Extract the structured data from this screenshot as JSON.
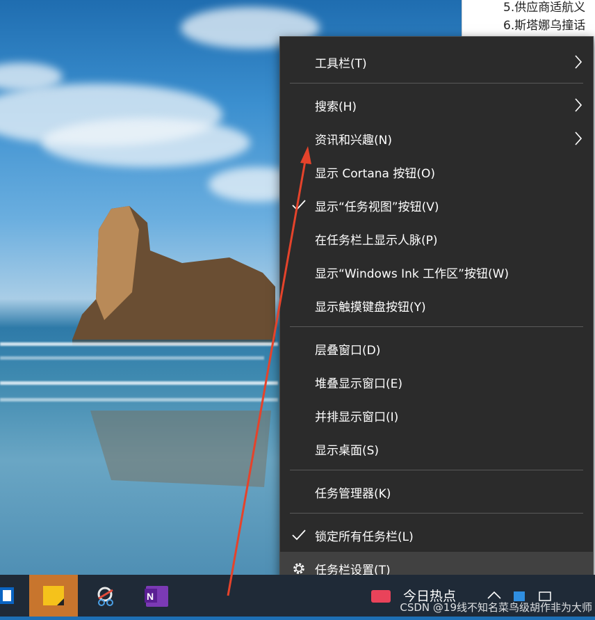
{
  "background_doc": {
    "lines": [
      "5.供应商适航义",
      "6.斯塔娜乌撞话"
    ]
  },
  "menu": {
    "items": [
      {
        "label": "工具栏(T)"
      },
      {
        "label": "搜索(H)"
      },
      {
        "label": "资讯和兴趣(N)"
      },
      {
        "label": "显示 Cortana 按钮(O)"
      },
      {
        "label": "显示“任务视图”按钮(V)"
      },
      {
        "label": "在任务栏上显示人脉(P)"
      },
      {
        "label": "显示“Windows Ink 工作区”按钮(W)"
      },
      {
        "label": "显示触摸键盘按钮(Y)"
      },
      {
        "label": "层叠窗口(D)"
      },
      {
        "label": "堆叠显示窗口(E)"
      },
      {
        "label": "并排显示窗口(I)"
      },
      {
        "label": "显示桌面(S)"
      },
      {
        "label": "任务管理器(K)"
      },
      {
        "label": "锁定所有任务栏(L)"
      },
      {
        "label": "任务栏设置(T)"
      }
    ]
  },
  "taskbar": {
    "apps": [
      "outlook-icon",
      "sticky-notes-icon",
      "snipping-tool-icon",
      "onenote-icon"
    ],
    "tray_text": "今日热点"
  },
  "watermark": "CSDN @19线不知名菜鸟级胡作非为大师",
  "colors": {
    "menu_bg": "#2b2b2b",
    "menu_hover": "#414141",
    "taskbar_bg": "#1f2a37",
    "active_app": "#c8752d",
    "annotation_arrow": "#e5432b"
  }
}
